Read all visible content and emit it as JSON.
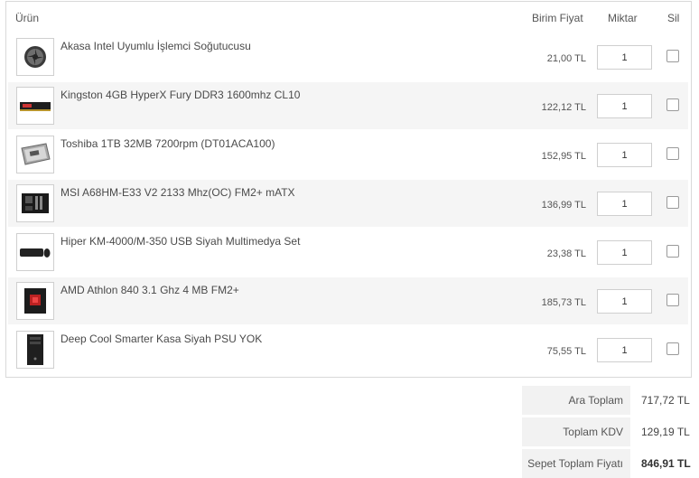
{
  "header": {
    "product": "Ürün",
    "unit_price": "Birim Fiyat",
    "quantity": "Miktar",
    "delete": "Sil"
  },
  "items": [
    {
      "name": "Akasa Intel Uyumlu İşlemci Soğutucusu",
      "price": "21,00 TL",
      "qty": "1",
      "icon": "cpu-cooler-icon"
    },
    {
      "name": "Kingston 4GB HyperX Fury DDR3 1600mhz CL10",
      "price": "122,12 TL",
      "qty": "1",
      "icon": "ram-module-icon"
    },
    {
      "name": "Toshiba 1TB 32MB 7200rpm (DT01ACA100)",
      "price": "152,95 TL",
      "qty": "1",
      "icon": "hard-drive-icon"
    },
    {
      "name": "MSI A68HM-E33 V2 2133 Mhz(OC) FM2+ mATX",
      "price": "136,99 TL",
      "qty": "1",
      "icon": "motherboard-icon"
    },
    {
      "name": "Hiper KM-4000/M-350 USB Siyah Multimedya Set",
      "price": "23,38 TL",
      "qty": "1",
      "icon": "keyboard-mouse-icon"
    },
    {
      "name": "AMD Athlon 840 3.1 Ghz 4 MB FM2+",
      "price": "185,73 TL",
      "qty": "1",
      "icon": "processor-box-icon"
    },
    {
      "name": "Deep Cool Smarter Kasa Siyah PSU YOK",
      "price": "75,55 TL",
      "qty": "1",
      "icon": "pc-case-icon"
    }
  ],
  "totals": {
    "subtotal_label": "Ara Toplam",
    "subtotal_value": "717,72 TL",
    "vat_label": "Toplam KDV",
    "vat_value": "129,19 TL",
    "grand_label": "Sepet Toplam Fiyatı",
    "grand_value": "846,91 TL"
  }
}
